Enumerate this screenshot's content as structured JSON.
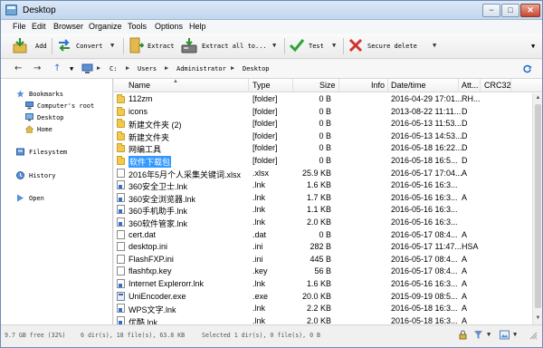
{
  "window": {
    "title": "Desktop",
    "minimize": "−",
    "maximize": "□",
    "close": "✕"
  },
  "menu": [
    "File",
    "Edit",
    "Browser",
    "Organize",
    "Tools",
    "Options",
    "Help"
  ],
  "toolbar": {
    "add": "Add",
    "convert": "Convert",
    "extract": "Extract",
    "extract_all": "Extract all to...",
    "test": "Test",
    "secure_delete": "Secure delete"
  },
  "address": {
    "back": "←",
    "forward": "→",
    "up": "↑",
    "crumbs": [
      "C:",
      "Users",
      "Administrator",
      "Desktop"
    ]
  },
  "sidebar": {
    "bookmarks": "Bookmarks",
    "computer_root": "Computer's root",
    "desktop": "Desktop",
    "home": "Home",
    "filesystem": "Filesystem",
    "history": "History",
    "open": "Open"
  },
  "columns": [
    "Name",
    "Type",
    "Size",
    "Info",
    "Date/time",
    "Att...",
    "CRC32"
  ],
  "files": [
    {
      "icon": "folder",
      "name": "112zm",
      "type": "[folder]",
      "size": "0 B",
      "info": "",
      "date": "2016-04-29 17:01...",
      "attr": "RH..."
    },
    {
      "icon": "folder",
      "name": "icons",
      "type": "[folder]",
      "size": "0 B",
      "info": "",
      "date": "2013-08-22 11:11...",
      "attr": "D"
    },
    {
      "icon": "folder",
      "name": "新建文件夹 (2)",
      "type": "[folder]",
      "size": "0 B",
      "info": "",
      "date": "2016-05-13 11:53...",
      "attr": "D"
    },
    {
      "icon": "folder",
      "name": "新建文件夹",
      "type": "[folder]",
      "size": "0 B",
      "info": "",
      "date": "2016-05-13 14:53...",
      "attr": "D"
    },
    {
      "icon": "folder",
      "name": "网编工具",
      "type": "[folder]",
      "size": "0 B",
      "info": "",
      "date": "2016-05-18 16:22...",
      "attr": "D"
    },
    {
      "icon": "folder",
      "name": "软件下载包",
      "type": "[folder]",
      "size": "0 B",
      "info": "",
      "date": "2016-05-18 16:5...",
      "attr": "D",
      "selected": true
    },
    {
      "icon": "file",
      "name": "2016年5月个人采集关键词.xlsx",
      "type": ".xlsx",
      "size": "25.9 KB",
      "info": "",
      "date": "2016-05-17 17:04...",
      "attr": "A"
    },
    {
      "icon": "link",
      "name": "360安全卫士.lnk",
      "type": ".lnk",
      "size": "1.6 KB",
      "info": "",
      "date": "2016-05-16 16:3...",
      "attr": ""
    },
    {
      "icon": "link",
      "name": "360安全浏览器.lnk",
      "type": ".lnk",
      "size": "1.7 KB",
      "info": "",
      "date": "2016-05-16 16:3...",
      "attr": "A"
    },
    {
      "icon": "link",
      "name": "360手机助手.lnk",
      "type": ".lnk",
      "size": "1.1 KB",
      "info": "",
      "date": "2016-05-16 16:3...",
      "attr": ""
    },
    {
      "icon": "link",
      "name": "360软件管家.lnk",
      "type": ".lnk",
      "size": "2.0 KB",
      "info": "",
      "date": "2016-05-16 16:3...",
      "attr": ""
    },
    {
      "icon": "file",
      "name": "cert.dat",
      "type": ".dat",
      "size": "0 B",
      "info": "",
      "date": "2016-05-17 08:4...",
      "attr": "A"
    },
    {
      "icon": "file",
      "name": "desktop.ini",
      "type": ".ini",
      "size": "282 B",
      "info": "",
      "date": "2016-05-17 11:47...",
      "attr": "HSA"
    },
    {
      "icon": "file",
      "name": "FlashFXP.ini",
      "type": ".ini",
      "size": "445 B",
      "info": "",
      "date": "2016-05-17 08:4...",
      "attr": "A"
    },
    {
      "icon": "file",
      "name": "flashfxp.key",
      "type": ".key",
      "size": "56 B",
      "info": "",
      "date": "2016-05-17 08:4...",
      "attr": "A"
    },
    {
      "icon": "link",
      "name": "Internet Explerorr.lnk",
      "type": ".lnk",
      "size": "1.6 KB",
      "info": "",
      "date": "2016-05-16 16:3...",
      "attr": "A"
    },
    {
      "icon": "exe",
      "name": "UniEncoder.exe",
      "type": ".exe",
      "size": "20.0 KB",
      "info": "",
      "date": "2015-09-19 08:5...",
      "attr": "A"
    },
    {
      "icon": "link",
      "name": "WPS文字.lnk",
      "type": ".lnk",
      "size": "2.2 KB",
      "info": "",
      "date": "2016-05-18 16:3...",
      "attr": "A"
    },
    {
      "icon": "link",
      "name": "优酷.lnk",
      "type": ".lnk",
      "size": "2.0 KB",
      "info": "",
      "date": "2016-05-18 16:3...",
      "attr": "A"
    }
  ],
  "status": {
    "free": "9.7 GB free (32%)",
    "counts": "6 dir(s), 18 file(s), 63.8 KB",
    "selected": "Selected 1 dir(s), 0 file(s), 0 B"
  },
  "colors": {
    "selection": "#3399ff",
    "folder": "#f2c94c",
    "title_bar": "#c2d6ee"
  },
  "icons": [
    "app-icon",
    "add-icon",
    "convert-icon",
    "extract-icon",
    "extract-all-icon",
    "test-icon",
    "delete-icon",
    "computer-icon",
    "bookmark-icon",
    "folder-icon",
    "file-icon",
    "shortcut-icon",
    "exe-icon"
  ]
}
